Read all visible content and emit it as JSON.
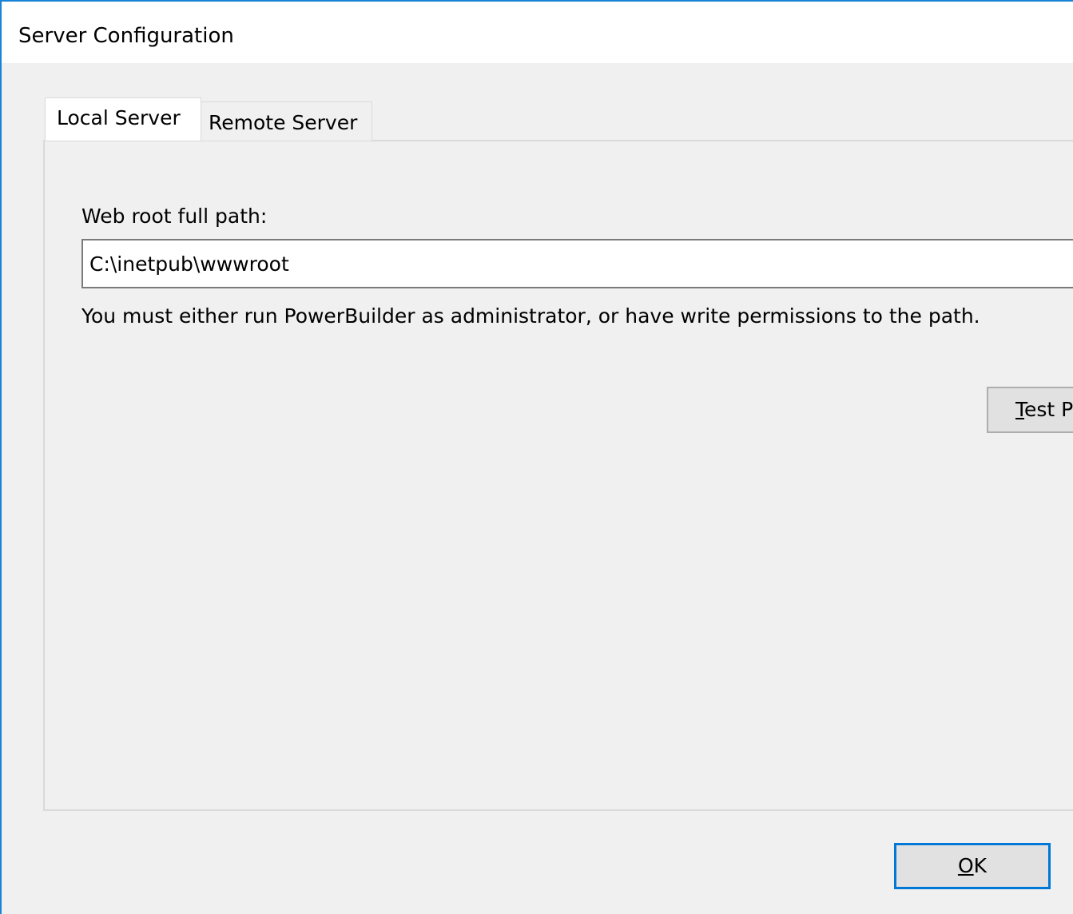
{
  "window": {
    "title": "Server Configuration"
  },
  "tabs": [
    {
      "label": "Local Server",
      "active": true
    },
    {
      "label": "Remote Server",
      "active": false
    }
  ],
  "local_server": {
    "web_root_label_pre": "Web root full path:",
    "web_root_value": "C:\\inetpub\\wwwroot",
    "hint": "You must either run PowerBuilder as administrator, or have write permissions to the path.",
    "test_button": {
      "mnemonic": "T",
      "rest": "est P"
    }
  },
  "footer": {
    "ok_button": {
      "mnemonic": "O",
      "rest": "K"
    }
  },
  "colors": {
    "accent": "#0078d7",
    "window_border": "#1883d7",
    "dialog_background": "#f0f0f0"
  }
}
